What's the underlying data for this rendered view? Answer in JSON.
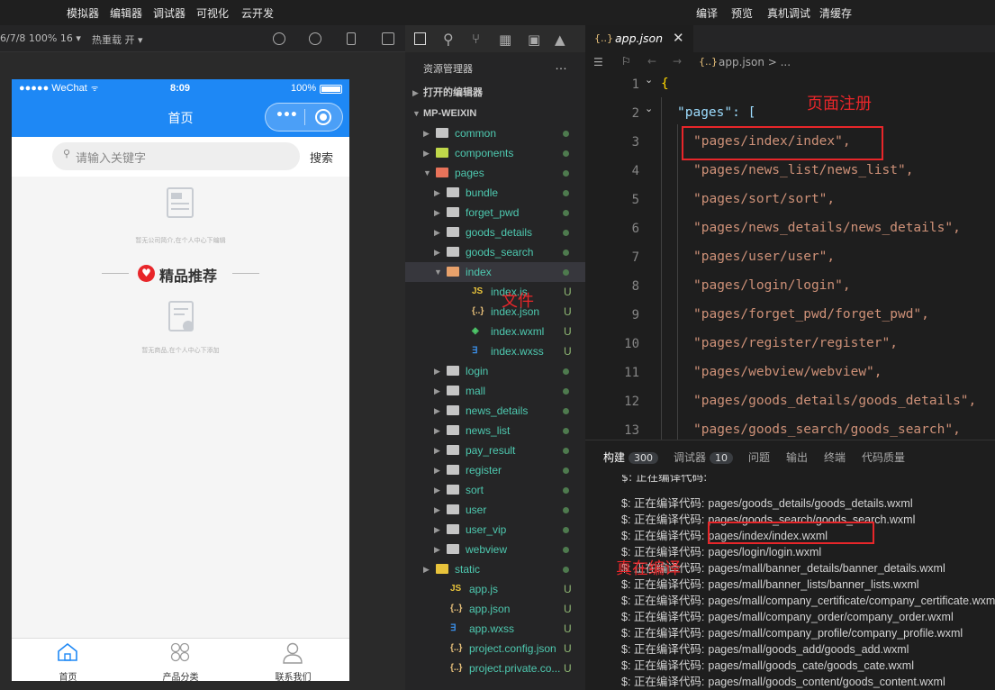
{
  "menubar": {
    "left": [
      "模拟器",
      "编辑器",
      "调试器",
      "可视化",
      "云开发"
    ],
    "right": [
      "编译",
      "预览",
      "真机调试",
      "清缓存"
    ]
  },
  "toolbar": {
    "device": "6/7/8 100% 16 ▾",
    "hotreload": "热重载 开 ▾"
  },
  "phone": {
    "status": {
      "carrier": "●●●●● WeChat",
      "time": "8:09",
      "battery": "100%"
    },
    "title": "首页",
    "search_placeholder": "请输入关键字",
    "search_button": "搜索",
    "empty_company": "暂无公司简介,在个人中心下编辑",
    "section_title": "精品推荐",
    "empty_goods": "暂无商品,在个人中心下添加",
    "tabs": [
      "首页",
      "产品分类",
      "联系我们"
    ]
  },
  "explorer": {
    "header": "资源管理器",
    "more": "…",
    "open_editors": "打开的编辑器",
    "project": "MP-WEIXIN",
    "items": [
      {
        "label": "common",
        "type": "folder",
        "status": "dot"
      },
      {
        "label": "components",
        "type": "folder",
        "status": "dot"
      },
      {
        "label": "pages",
        "type": "folder-open",
        "status": "dot"
      },
      {
        "label": "bundle",
        "type": "folder",
        "status": "dot"
      },
      {
        "label": "forget_pwd",
        "type": "folder",
        "status": "dot"
      },
      {
        "label": "goods_details",
        "type": "folder",
        "status": "dot"
      },
      {
        "label": "goods_search",
        "type": "folder",
        "status": "dot"
      },
      {
        "label": "index",
        "type": "folder-open",
        "status": "dot"
      },
      {
        "label": "index.js",
        "type": "js",
        "status": "U"
      },
      {
        "label": "index.json",
        "type": "json",
        "status": "U"
      },
      {
        "label": "index.wxml",
        "type": "wxml",
        "status": "U"
      },
      {
        "label": "index.wxss",
        "type": "wxss",
        "status": "U"
      },
      {
        "label": "login",
        "type": "folder",
        "status": "dot"
      },
      {
        "label": "mall",
        "type": "folder",
        "status": "dot"
      },
      {
        "label": "news_details",
        "type": "folder",
        "status": "dot"
      },
      {
        "label": "news_list",
        "type": "folder",
        "status": "dot"
      },
      {
        "label": "pay_result",
        "type": "folder",
        "status": "dot"
      },
      {
        "label": "register",
        "type": "folder",
        "status": "dot"
      },
      {
        "label": "sort",
        "type": "folder",
        "status": "dot"
      },
      {
        "label": "user",
        "type": "folder",
        "status": "dot"
      },
      {
        "label": "user_vip",
        "type": "folder",
        "status": "dot"
      },
      {
        "label": "webview",
        "type": "folder",
        "status": "dot"
      },
      {
        "label": "static",
        "type": "folder",
        "status": "dot"
      },
      {
        "label": "app.js",
        "type": "js",
        "status": "U"
      },
      {
        "label": "app.json",
        "type": "json",
        "status": "U"
      },
      {
        "label": "app.wxss",
        "type": "wxss",
        "status": "U"
      },
      {
        "label": "project.config.json",
        "type": "json",
        "status": "U"
      },
      {
        "label": "project.private.co...",
        "type": "json",
        "status": "U"
      }
    ]
  },
  "editor": {
    "tab": "app.json",
    "tab_icon": "{..}",
    "breadcrumb": "app.json > ...",
    "lines": [
      {
        "n": "1",
        "text": "{"
      },
      {
        "n": "2",
        "text": "\"pages\": ["
      },
      {
        "n": "3",
        "text": "\"pages/index/index\","
      },
      {
        "n": "4",
        "text": "\"pages/news_list/news_list\","
      },
      {
        "n": "5",
        "text": "\"pages/sort/sort\","
      },
      {
        "n": "6",
        "text": "\"pages/news_details/news_details\","
      },
      {
        "n": "7",
        "text": "\"pages/user/user\","
      },
      {
        "n": "8",
        "text": "\"pages/login/login\","
      },
      {
        "n": "9",
        "text": "\"pages/forget_pwd/forget_pwd\","
      },
      {
        "n": "10",
        "text": "\"pages/register/register\","
      },
      {
        "n": "11",
        "text": "\"pages/webview/webview\","
      },
      {
        "n": "12",
        "text": "\"pages/goods_details/goods_details\","
      },
      {
        "n": "13",
        "text": "\"pages/goods_search/goods_search\","
      }
    ]
  },
  "panel": {
    "tabs": [
      {
        "label": "构建",
        "badge": "300"
      },
      {
        "label": "调试器",
        "badge": "10"
      },
      {
        "label": "问题",
        "badge": ""
      },
      {
        "label": "输出",
        "badge": ""
      },
      {
        "label": "终端",
        "badge": ""
      },
      {
        "label": "代码质量",
        "badge": ""
      }
    ],
    "prefix": "$: 正在编译代码:",
    "logs": [
      "pages/goods_details/goods_details.wxml",
      "pages/goods_search/goods_search.wxml",
      "pages/index/index.wxml",
      "pages/login/login.wxml",
      "pages/mall/banner_details/banner_details.wxml",
      "pages/mall/banner_lists/banner_lists.wxml",
      "pages/mall/company_certificate/company_certificate.wxml",
      "pages/mall/company_order/company_order.wxml",
      "pages/mall/company_profile/company_profile.wxml",
      "pages/mall/goods_add/goods_add.wxml",
      "pages/mall/goods_cate/goods_cate.wxml",
      "pages/mall/goods_content/goods_content.wxml"
    ]
  },
  "annotations": {
    "page_register": "页面注册",
    "files": "文件",
    "compile": "真在编译"
  },
  "colors": {
    "accent": "#1e88f5",
    "annotation": "#e8262a",
    "folder_text": "#4ec9b0"
  }
}
